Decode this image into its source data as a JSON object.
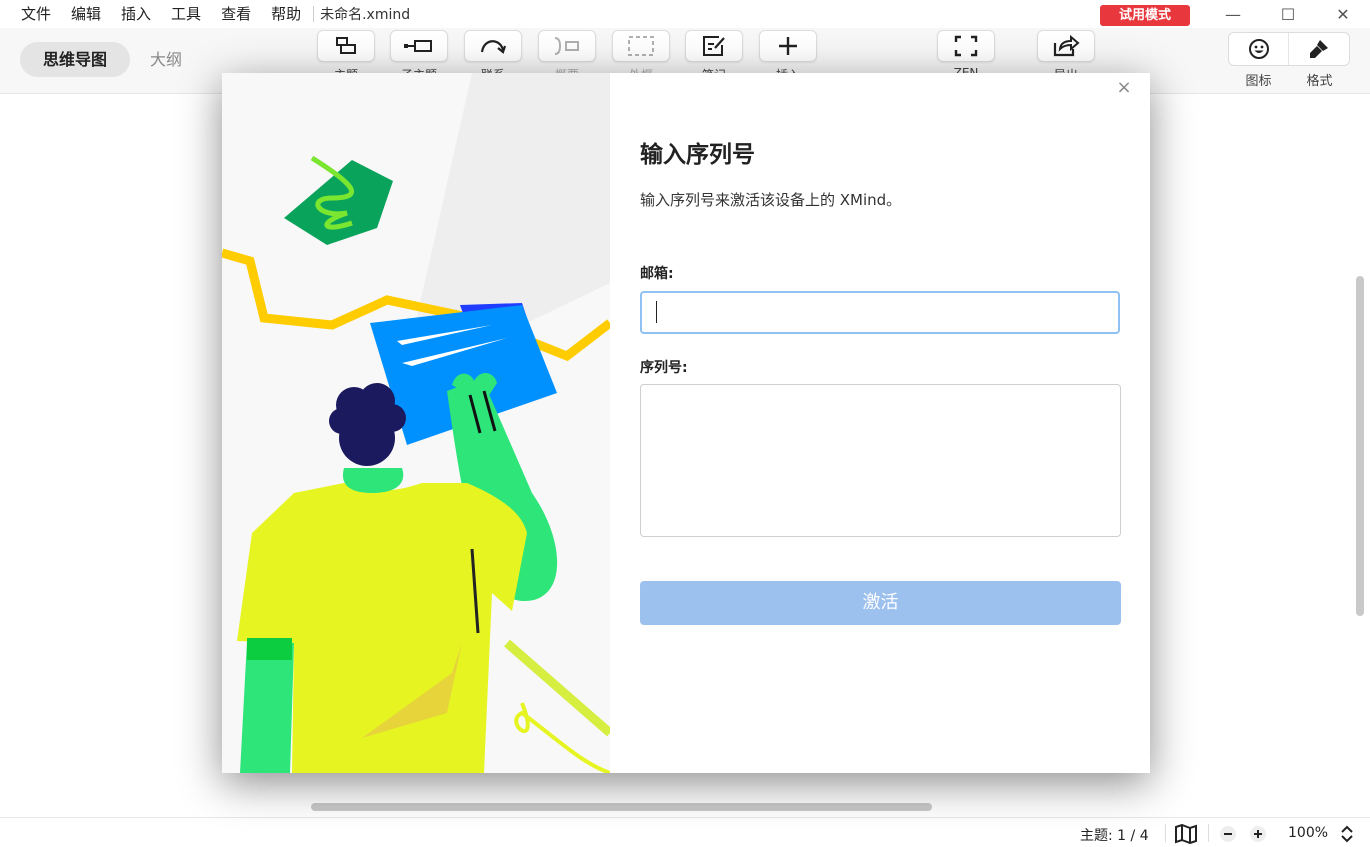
{
  "menu": {
    "items": [
      "文件",
      "编辑",
      "插入",
      "工具",
      "查看",
      "帮助"
    ],
    "doc_title": "未命名.xmind"
  },
  "badge": {
    "trial": "试用模式"
  },
  "window": {
    "minimize": "—",
    "maximize": "☐",
    "close": "✕"
  },
  "toolbar": {
    "view_mindmap": "思维导图",
    "view_outline": "大纲",
    "buttons": [
      {
        "label": "主题",
        "icon": "topic-icon"
      },
      {
        "label": "子主题",
        "icon": "subtopic-icon"
      },
      {
        "label": "联系",
        "icon": "relationship-icon"
      },
      {
        "label": "概要",
        "icon": "summary-icon"
      },
      {
        "label": "外框",
        "icon": "boundary-icon"
      },
      {
        "label": "笔记",
        "icon": "notes-icon"
      },
      {
        "label": "插入",
        "icon": "plus-icon"
      },
      {
        "label": "ZEN",
        "icon": "fullscreen-icon"
      },
      {
        "label": "导出",
        "icon": "export-icon"
      }
    ],
    "right": {
      "icon_label": "图标",
      "format_label": "格式"
    }
  },
  "dialog": {
    "close": "×",
    "title": "输入序列号",
    "description": "输入序列号来激活该设备上的 XMind。",
    "email_label": "邮箱:",
    "email_value": "",
    "serial_label": "序列号:",
    "serial_value": "",
    "activate_label": "激活"
  },
  "status": {
    "topic_count": "主题: 1 / 4",
    "zoom": "100%"
  },
  "colors": {
    "trial_badge": "#e8383d",
    "activate_button": "#9cc1ee",
    "input_focus_border": "#8fc1f3"
  }
}
